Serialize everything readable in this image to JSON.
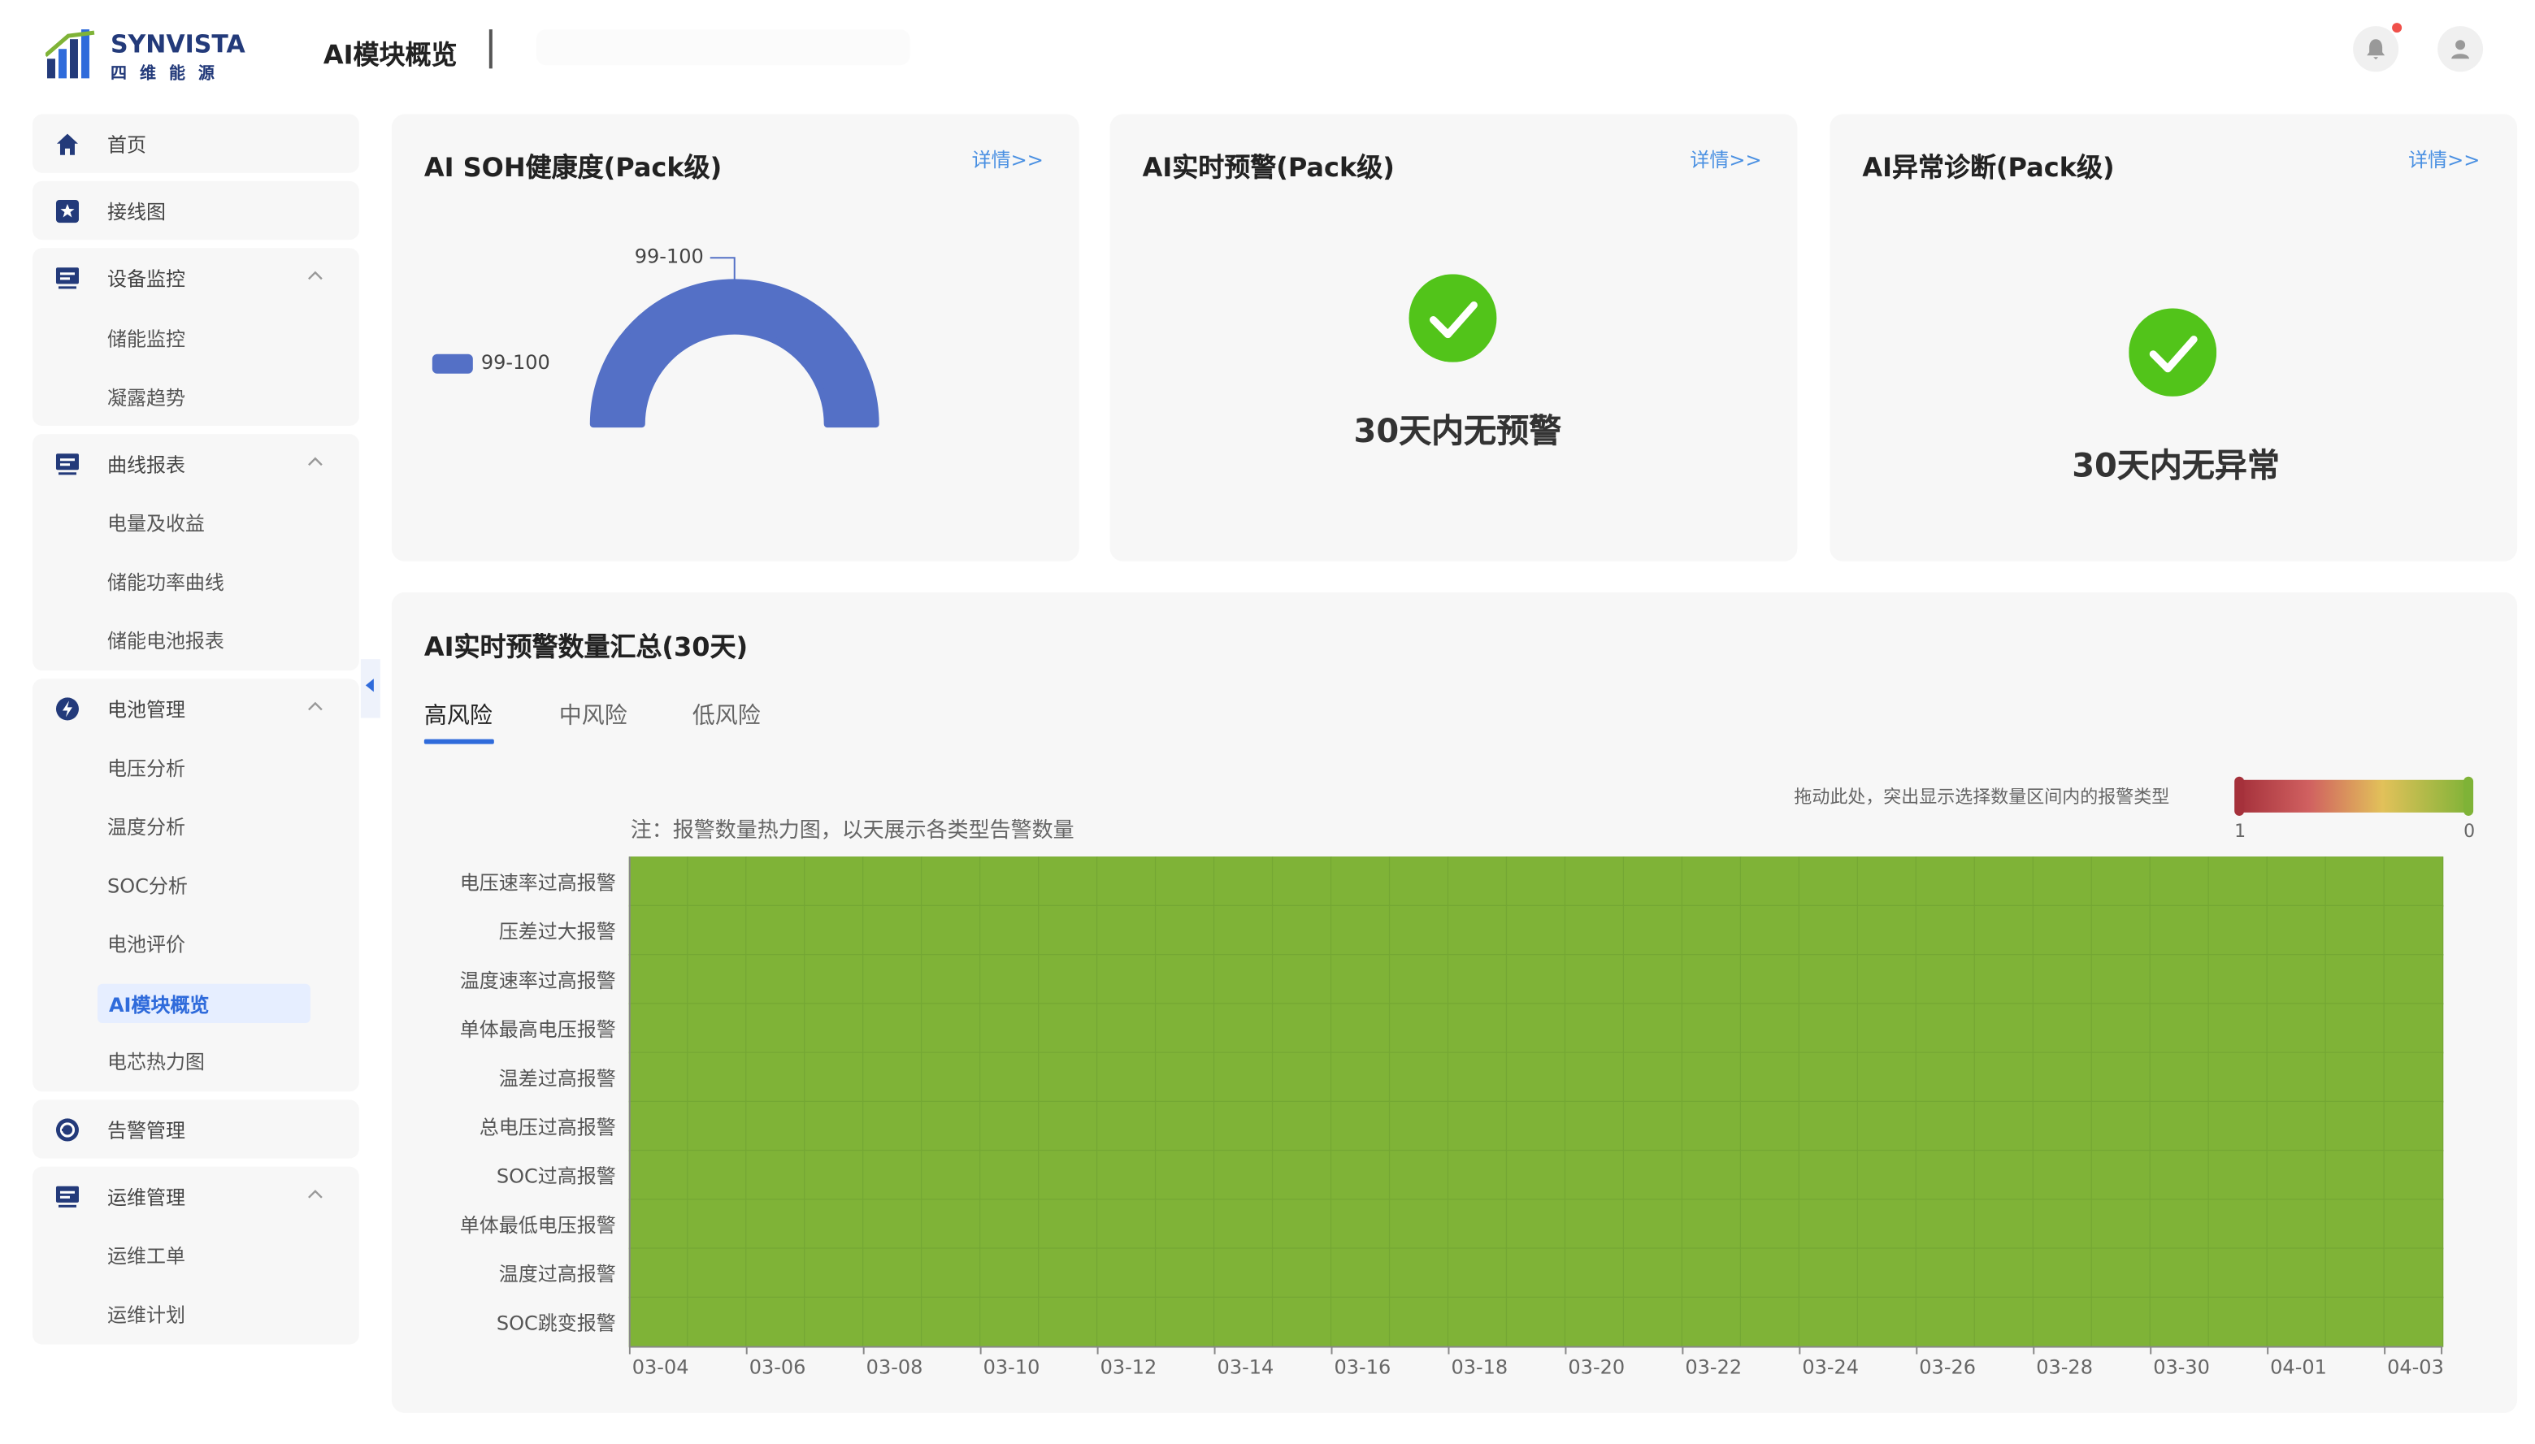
{
  "header": {
    "logo_text": "SYNVISTA",
    "logo_sub": "四维能源",
    "page_title": "AI模块概览",
    "icons": {
      "bell": "bell-icon",
      "user": "user-avatar-icon"
    }
  },
  "sidebar": {
    "home": "首页",
    "wiring": "接线图",
    "device_monitor": {
      "label": "设备监控",
      "items": [
        "储能监控",
        "凝露趋势"
      ]
    },
    "curve_report": {
      "label": "曲线报表",
      "items": [
        "电量及收益",
        "储能功率曲线",
        "储能电池报表"
      ]
    },
    "battery_mgmt": {
      "label": "电池管理",
      "items": [
        "电压分析",
        "温度分析",
        "SOC分析",
        "电池评价",
        "AI模块概览",
        "电芯热力图"
      ]
    },
    "alarm_mgmt": "告警管理",
    "ops_mgmt": {
      "label": "运维管理",
      "items": [
        "运维工单",
        "运维计划"
      ]
    }
  },
  "cards": {
    "soh": {
      "title": "AI SOH健康度(Pack级)",
      "more": "详情>>"
    },
    "warning": {
      "title": "AI实时预警(Pack级)",
      "more": "详情>>",
      "status": "30天内无预警"
    },
    "diagnosis": {
      "title": "AI异常诊断(Pack级)",
      "more": "详情>>",
      "status": "30天内无异常"
    }
  },
  "summary": {
    "title": "AI实时预警数量汇总(30天)",
    "tabs": [
      "高风险",
      "中风险",
      "低风险"
    ],
    "note": "注：报警数量热力图，以天展示各类型告警数量",
    "visualmap_hint": "拖动此处，突出显示选择数量区间内的报警类型",
    "visualmap_min": "1",
    "visualmap_max": "0"
  },
  "chart_data": [
    {
      "type": "pie",
      "categories": [
        "99-100"
      ],
      "values": [
        1
      ],
      "legend": [
        "99-100"
      ],
      "data_label": "99-100",
      "colors": [
        "#5470c6"
      ]
    },
    {
      "type": "heatmap",
      "x": [
        "03-04",
        "03-05",
        "03-06",
        "03-07",
        "03-08",
        "03-09",
        "03-10",
        "03-11",
        "03-12",
        "03-13",
        "03-14",
        "03-15",
        "03-16",
        "03-17",
        "03-18",
        "03-19",
        "03-20",
        "03-21",
        "03-22",
        "03-23",
        "03-24",
        "03-25",
        "03-26",
        "03-27",
        "03-28",
        "03-29",
        "03-30",
        "03-31",
        "04-01",
        "04-02",
        "04-03"
      ],
      "x_tick_labels": [
        "03-04",
        "03-06",
        "03-08",
        "03-10",
        "03-12",
        "03-14",
        "03-16",
        "03-18",
        "03-20",
        "03-22",
        "03-24",
        "03-26",
        "03-28",
        "03-30",
        "04-01",
        "04-03"
      ],
      "y": [
        "电压速率过高报警",
        "压差过大报警",
        "温度速率过高报警",
        "单体最高电压报警",
        "温差过高报警",
        "总电压过高报警",
        "SOC过高报警",
        "单体最低电压报警",
        "温度过高报警",
        "SOC跳变报警"
      ],
      "value_all": 0,
      "visualmap_range": [
        0,
        1
      ],
      "colors": {
        "high": "#a5313b",
        "low": "#7fb337"
      }
    }
  ]
}
